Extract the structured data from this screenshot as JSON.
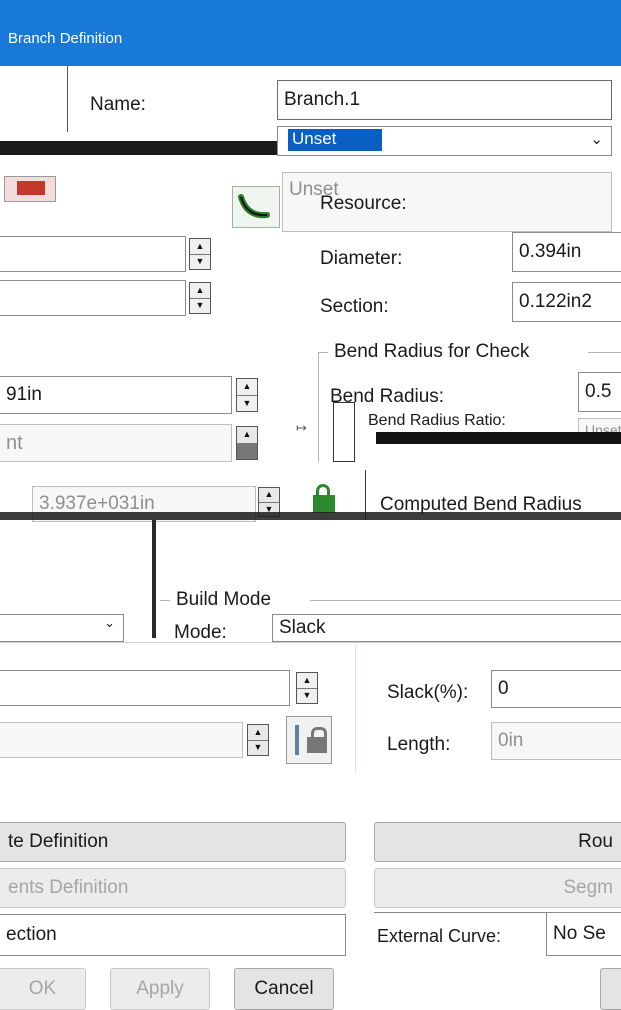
{
  "titlebar": {
    "title": "Branch Definition"
  },
  "name": {
    "label": "Name:",
    "value": "Branch.1"
  },
  "dropdown": {
    "value": "Unset",
    "list_item": "Unset"
  },
  "resource": {
    "label": "Resource:",
    "diameter_label": "Diameter:",
    "diameter_value": "0.394in",
    "section_label": "Section:",
    "section_value": "0.122in2"
  },
  "bend_group": {
    "title": "Bend Radius for Check",
    "bend_radius_label": "Bend Radius:",
    "bend_radius_value": "0.5",
    "ratio_label": "Bend Radius Ratio:",
    "ratio_value": "Unset",
    "computed_label": "Computed Bend Radius"
  },
  "left_fields": {
    "field3_value": "91in",
    "field4_value": "nt",
    "field5_value": "3.937e+031in"
  },
  "build_mode": {
    "title": "Build Mode",
    "mode_label": "Mode:",
    "mode_value": "Slack"
  },
  "slack": {
    "label": "Slack(%):",
    "value": "0"
  },
  "length": {
    "label": "Length:",
    "value": "0in"
  },
  "buttons": {
    "route_definition": "te Definition",
    "route": "Rou",
    "segments_definition": "ents Definition",
    "segments": "Segm",
    "ok": "OK",
    "apply": "Apply",
    "cancel": "Cancel"
  },
  "connection": {
    "value": "ection"
  },
  "external_curve": {
    "label": "External Curve:",
    "value": "No Se"
  }
}
